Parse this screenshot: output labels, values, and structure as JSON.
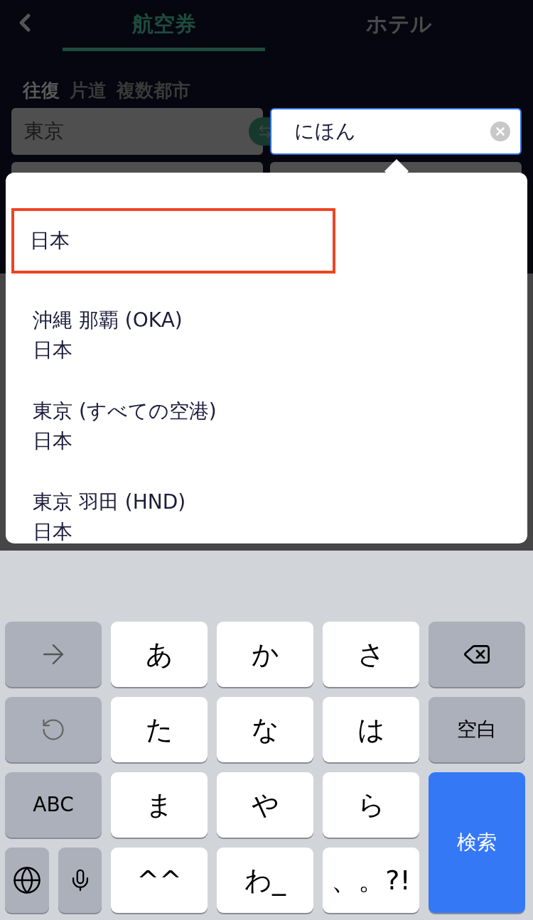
{
  "tabs": [
    {
      "label": "航空券",
      "selected": true
    },
    {
      "label": "ホテル",
      "selected": false
    }
  ],
  "trip_types": [
    {
      "label": "往復",
      "selected": true
    },
    {
      "label": "片道",
      "selected": false
    },
    {
      "label": "複数都市",
      "selected": false
    }
  ],
  "origin_field": {
    "value": "東京"
  },
  "destination_field": {
    "value": "にほん"
  },
  "suggestions": [
    {
      "title": "日本",
      "selected": true
    },
    {
      "title": "沖縄 那覇 (OKA)",
      "subtitle": "日本",
      "selected": false
    },
    {
      "title": "東京 (すべての空港)",
      "subtitle": "日本",
      "selected": false
    },
    {
      "title": "東京 羽田 (HND)",
      "subtitle": "日本",
      "selected": false
    }
  ],
  "keyboard": [
    {
      "kind": "next"
    },
    {
      "kind": "kana",
      "label": "あ"
    },
    {
      "kind": "kana",
      "label": "か"
    },
    {
      "kind": "kana",
      "label": "さ"
    },
    {
      "kind": "backspace"
    },
    {
      "kind": "undo"
    },
    {
      "kind": "kana",
      "label": "た"
    },
    {
      "kind": "kana",
      "label": "な"
    },
    {
      "kind": "kana",
      "label": "は"
    },
    {
      "kind": "function",
      "label": "空白"
    },
    {
      "kind": "function",
      "label": "ABC"
    },
    {
      "kind": "kana",
      "label": "ま"
    },
    {
      "kind": "kana",
      "label": "や"
    },
    {
      "kind": "kana",
      "label": "ら"
    },
    {
      "kind": "action",
      "label": "検索"
    },
    {
      "kind": "globe"
    },
    {
      "kind": "mic"
    },
    {
      "kind": "kana",
      "label": "^^"
    },
    {
      "kind": "kana",
      "label": "わ_"
    },
    {
      "kind": "kana",
      "label": "、。?!"
    }
  ]
}
